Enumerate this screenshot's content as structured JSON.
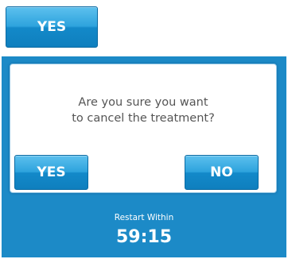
{
  "top_button": {
    "label": "YES"
  },
  "dialog": {
    "message": "Are you sure you want\nto cancel the treatment?",
    "yes_label": "YES",
    "no_label": "NO"
  },
  "restart": {
    "label": "Restart Within",
    "countdown": "59:15"
  },
  "colors": {
    "accent_blue": "#1c8ac7",
    "button_gradient_top": "#5cc0ee",
    "button_gradient_bottom": "#0f7fbe",
    "message_text": "#555555"
  }
}
